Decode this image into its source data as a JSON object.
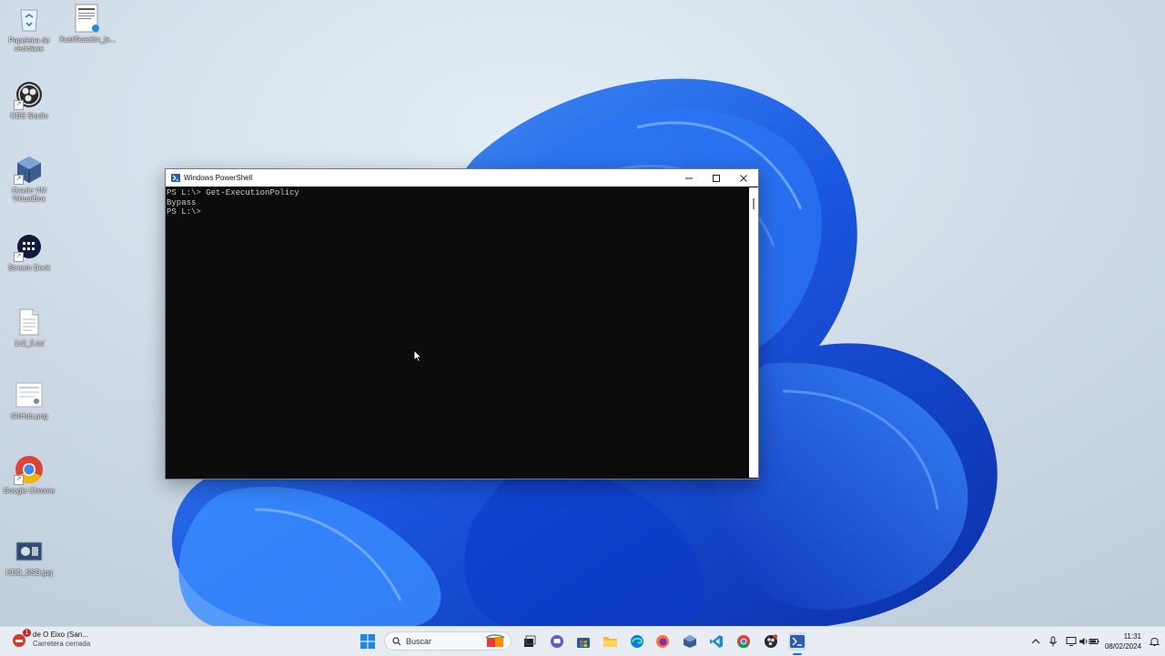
{
  "desktop": {
    "icons": [
      {
        "label": "Papeleira de reciclaxe",
        "icon": "recycle-bin-icon"
      },
      {
        "label": "Xustificación_ja...",
        "icon": "document-thumbnail-icon"
      },
      {
        "label": "OBS Studio",
        "icon": "obs-studio-icon"
      },
      {
        "label": "Oracle VM VirtualBox",
        "icon": "virtualbox-icon"
      },
      {
        "label": "Stream Deck",
        "icon": "stream-deck-icon"
      },
      {
        "label": "1x2_5.txt",
        "icon": "text-file-icon"
      },
      {
        "label": "GitHub.png",
        "icon": "image-file-icon"
      },
      {
        "label": "Google Chrome",
        "icon": "chrome-icon"
      },
      {
        "label": "HDD_SSD.jpg",
        "icon": "image-file-icon"
      }
    ]
  },
  "window": {
    "title": "Windows PowerShell",
    "lines": [
      "PS L:\\> Get-ExecutionPolicy",
      "Bypass",
      "PS L:\\>"
    ]
  },
  "taskbar": {
    "weather_line1": "de O Eixo (San...",
    "weather_line2": "Carretera cerrada",
    "weather_badge": "1",
    "search_placeholder": "Buscar",
    "pinned": [
      "start-icon",
      "file-explorer-icon",
      "teams-chat-icon",
      "microsoft-store-icon",
      "folder-icon",
      "edge-icon",
      "firefox-icon",
      "virtualbox-icon",
      "vscode-icon",
      "chrome-icon",
      "obs-studio-icon",
      "powershell-icon"
    ],
    "time": "11:31",
    "date": "08/02/2024"
  },
  "colors": {
    "terminal_bg": "#0c0c0c",
    "terminal_fg": "#cccccc",
    "wallpaper_blue": "#1f5fe0",
    "taskbar_bg": "#e8edf3"
  }
}
